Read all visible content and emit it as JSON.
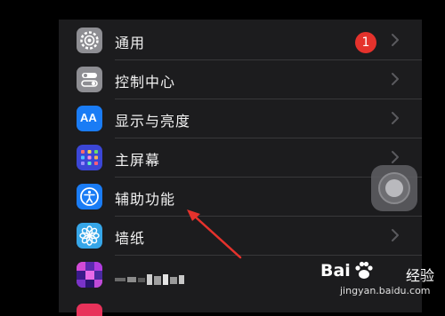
{
  "settings": {
    "items": [
      {
        "label": "通用",
        "icon": "gear-icon",
        "color": "#8e8e93",
        "badge": "1"
      },
      {
        "label": "控制中心",
        "icon": "toggles-icon",
        "color": "#8e8e93"
      },
      {
        "label": "显示与亮度",
        "icon": "aa-icon",
        "icon_text": "AA",
        "color": "#1a7cf5"
      },
      {
        "label": "主屏幕",
        "icon": "home-grid-icon",
        "color": "#3b46d6"
      },
      {
        "label": "辅助功能",
        "icon": "accessibility-icon",
        "color": "#1a7cf5"
      },
      {
        "label": "墙纸",
        "icon": "flower-icon",
        "color": "#36a6e8"
      },
      {
        "label": "",
        "icon": "blurred-icon",
        "color": "#9a3fd0"
      }
    ]
  },
  "watermark": {
    "brand": "Bai",
    "brand_suffix": "经验",
    "url": "jingyan.baidu.com"
  },
  "colors": {
    "annotation_arrow": "#e5322c",
    "background": "#1c1c1e",
    "badge": "#e5322c"
  }
}
